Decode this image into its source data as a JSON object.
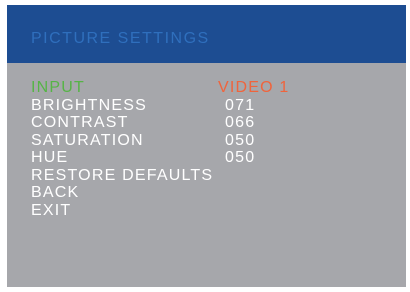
{
  "title": "PICTURE SETTINGS",
  "colors": {
    "panel_background": "#a6a7ab",
    "title_bar": "#1d4d92",
    "title_text": "#2f6fbd",
    "selected_item": "#56b446",
    "selected_value": "#f0643c",
    "text": "#ffffff"
  },
  "menu": {
    "selected_index": 0,
    "items": [
      {
        "label": "INPUT",
        "value": "VIDEO 1"
      },
      {
        "label": "BRIGHTNESS",
        "value": "071"
      },
      {
        "label": "CONTRAST",
        "value": "066"
      },
      {
        "label": "SATURATION",
        "value": "050"
      },
      {
        "label": "HUE",
        "value": "050"
      },
      {
        "label": "RESTORE DEFAULTS"
      },
      {
        "label": "BACK"
      },
      {
        "label": "EXIT"
      }
    ]
  }
}
